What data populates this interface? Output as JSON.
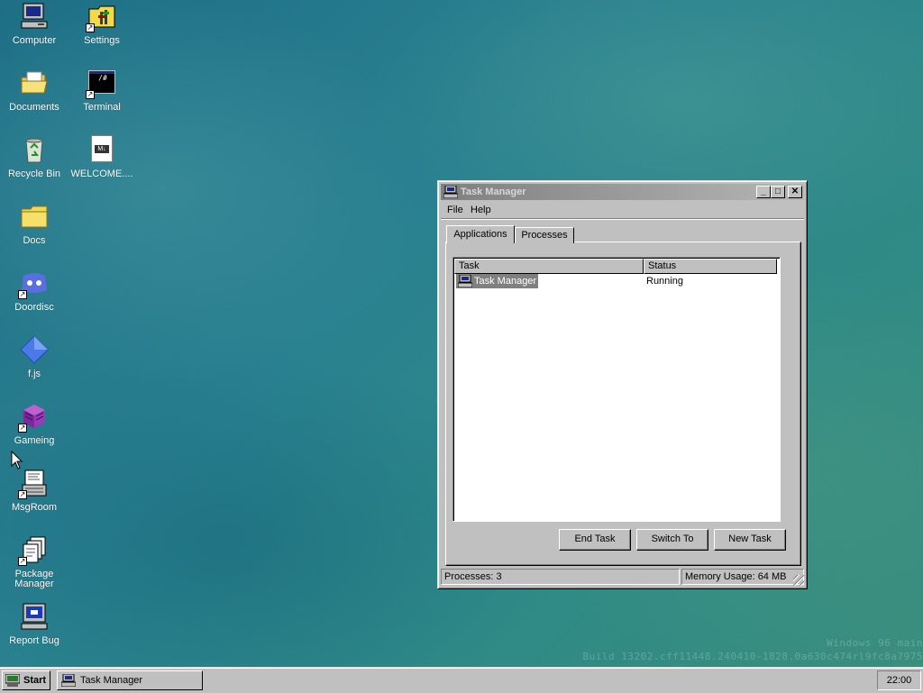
{
  "desktop": {
    "icons": [
      {
        "label": "Computer",
        "icon": "computer-icon"
      },
      {
        "label": "Settings",
        "icon": "settings-icon"
      },
      {
        "label": "Documents",
        "icon": "folder-open-icon"
      },
      {
        "label": "Terminal",
        "icon": "terminal-icon"
      },
      {
        "label": "Recycle Bin",
        "icon": "recycle-bin-icon"
      },
      {
        "label": "WELCOME....",
        "icon": "markdown-file-icon"
      },
      {
        "label": "Docs",
        "icon": "folder-icon"
      },
      {
        "label": "Doordisc",
        "icon": "doordisc-icon"
      },
      {
        "label": "f.js",
        "icon": "diamond-icon"
      },
      {
        "label": "Gameing",
        "icon": "game-cube-icon"
      },
      {
        "label": "MsgRoom",
        "icon": "msgroom-icon"
      },
      {
        "label": "Package\nManager",
        "icon": "package-manager-icon"
      },
      {
        "label": "Report Bug",
        "icon": "report-bug-icon"
      }
    ],
    "terminal_prompt": "/#",
    "markdown_badge": "M↓",
    "watermark": {
      "line1": "Windows 96 main",
      "line2": "Build 13202.cff11448.240410-1828.0a630c474rl9fc8a7975"
    }
  },
  "window": {
    "title": "Task Manager",
    "minimize": "_",
    "maximize": "□",
    "close": "✕",
    "menu": [
      "File",
      "Help"
    ],
    "tabs": [
      "Applications",
      "Processes"
    ],
    "active_tab": "Applications",
    "columns": [
      "Task",
      "Status"
    ],
    "rows": [
      {
        "task": "Task Manager",
        "status": "Running"
      }
    ],
    "buttons": {
      "end_task": "End Task",
      "switch_to": "Switch To",
      "new_task": "New Task"
    },
    "status": {
      "processes": "Processes: 3",
      "memory": "Memory Usage: 64 MB"
    }
  },
  "taskbar": {
    "start_label": "Start",
    "task_button": "Task Manager",
    "clock": "22:00"
  }
}
